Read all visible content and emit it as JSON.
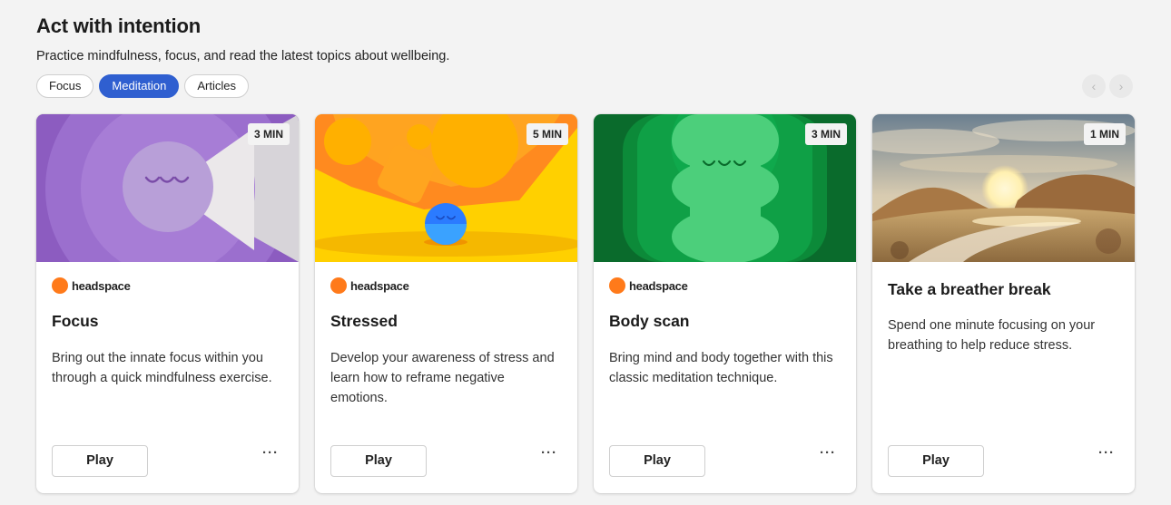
{
  "header": {
    "title": "Act with intention",
    "subtitle": "Practice mindfulness, focus, and read the latest topics about wellbeing."
  },
  "filters": [
    {
      "label": "Focus",
      "active": false
    },
    {
      "label": "Meditation",
      "active": true
    },
    {
      "label": "Articles",
      "active": false
    }
  ],
  "nav": {
    "prev_icon": "chevron-left-icon",
    "next_icon": "chevron-right-icon"
  },
  "cards": [
    {
      "duration": "3 MIN",
      "brand": "headspace",
      "title": "Focus",
      "description": "Bring out the innate focus within you through a quick mindfulness exercise.",
      "play_label": "Play",
      "more_label": "···"
    },
    {
      "duration": "5 MIN",
      "brand": "headspace",
      "title": "Stressed",
      "description": "Develop your awareness of stress and learn how to reframe negative emotions.",
      "play_label": "Play",
      "more_label": "···"
    },
    {
      "duration": "3 MIN",
      "brand": "headspace",
      "title": "Body scan",
      "description": "Bring mind and body together with this classic meditation technique.",
      "play_label": "Play",
      "more_label": "···"
    },
    {
      "duration": "1 MIN",
      "brand": "",
      "title": "Take a breather break",
      "description": "Spend one minute focusing on your breathing to help reduce stress.",
      "play_label": "Play",
      "more_label": "···"
    }
  ],
  "colors": {
    "accent": "#2f5fd0",
    "brand_dot": "#ff7a1a",
    "page_bg": "#f3f3f3"
  }
}
